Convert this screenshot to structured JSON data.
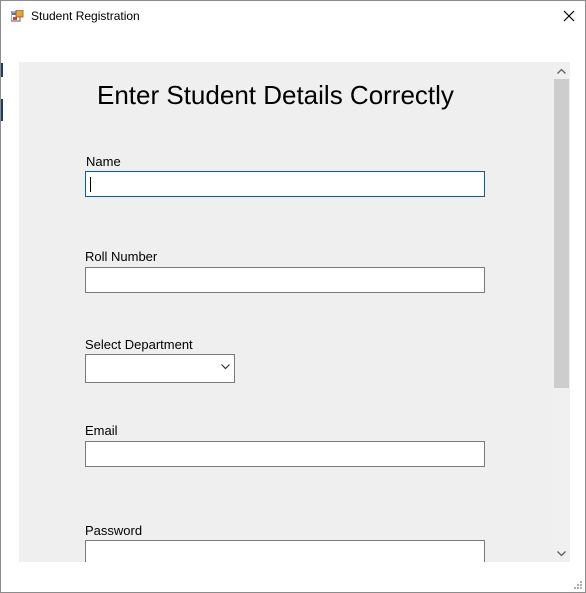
{
  "window": {
    "title": "Student Registration",
    "app_icon": "windows-form-icon",
    "close_icon": "close-icon"
  },
  "form": {
    "heading": "Enter Student Details Correctly",
    "name_label": "Name",
    "name_value": "",
    "roll_label": "Roll Number",
    "roll_value": "",
    "department_label": "Select Department",
    "department_value": "",
    "email_label": "Email",
    "email_value": "",
    "password_label": "Password",
    "password_value": ""
  },
  "scrollbar": {
    "up_icon": "scroll-up-arrow-icon",
    "down_icon": "scroll-down-arrow-icon"
  },
  "colors": {
    "panel_background": "#efefef",
    "focus_border": "#0a5aa5",
    "scroll_thumb": "#cdcdcd"
  }
}
